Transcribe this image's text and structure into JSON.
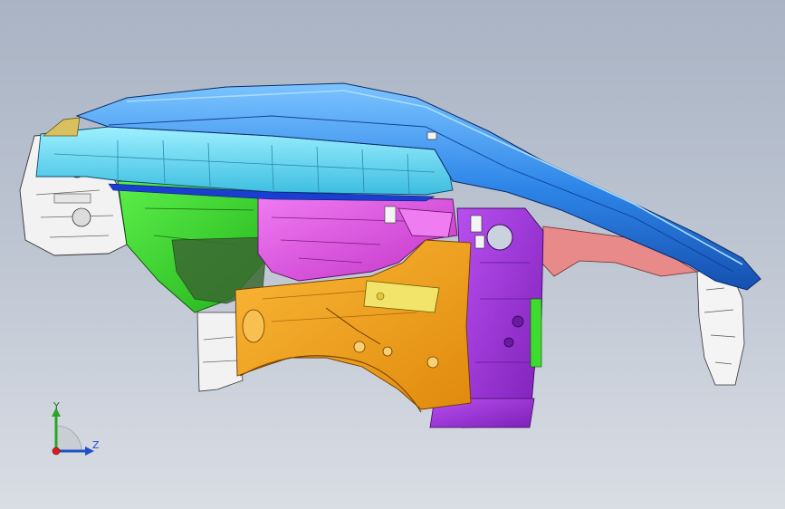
{
  "viewport": {
    "background_top": "#a9b3c3",
    "background_bottom": "#d9dde4"
  },
  "part_colors": {
    "roof_rail": "#2e86e8",
    "inner_panel": "#64d8f2",
    "front_bracket": "#f2f2f2",
    "green_panel": "#3ddc2e",
    "magenta_panel": "#e04de6",
    "orange_panel": "#f5a31a",
    "purple_panel": "#9b2fd6",
    "yellow_plate": "#f2e36a",
    "pink_panel": "#e88a8a"
  },
  "triad": {
    "y_label": "Y",
    "z_label": "Z",
    "y_color": "#2aa52a",
    "z_color": "#1f4fc9",
    "x_color": "#d62020"
  }
}
